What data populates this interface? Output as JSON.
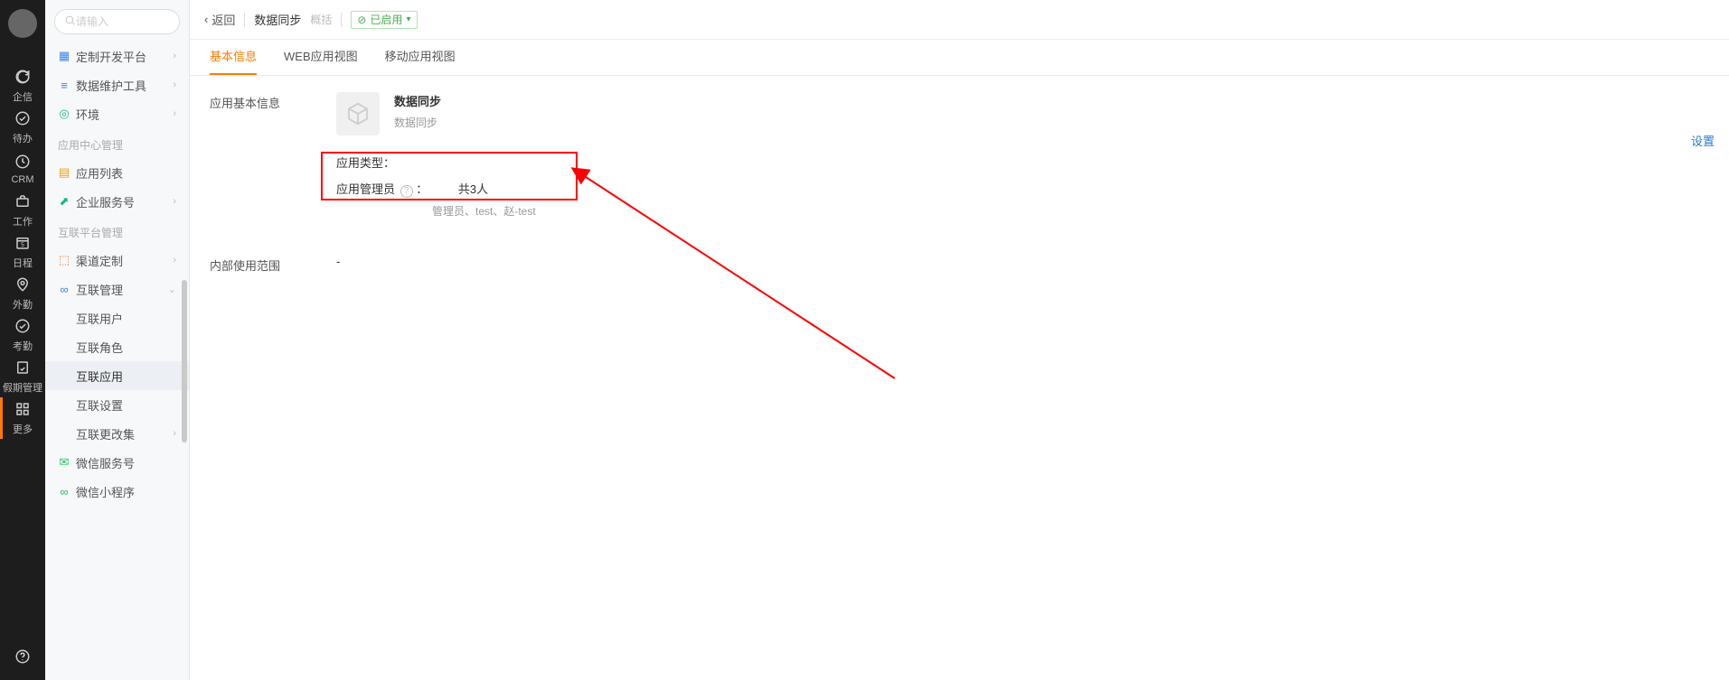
{
  "rail": {
    "items": [
      {
        "id": "qixin",
        "label": "企信"
      },
      {
        "id": "daiban",
        "label": "待办"
      },
      {
        "id": "crm",
        "label": "CRM"
      },
      {
        "id": "gongzuo",
        "label": "工作"
      },
      {
        "id": "richeng",
        "label": "日程",
        "badge": "5"
      },
      {
        "id": "waiqin",
        "label": "外勤"
      },
      {
        "id": "kaoqin",
        "label": "考勤"
      },
      {
        "id": "jiaqi",
        "label": "假期管理"
      },
      {
        "id": "gengduo",
        "label": "更多"
      }
    ]
  },
  "sidebar": {
    "search_placeholder": "请输入",
    "groups": [
      {
        "items": [
          {
            "label": "定制开发平台",
            "icon": "grid",
            "icon_color": "#3b82f6",
            "has_children": true
          },
          {
            "label": "数据维护工具",
            "icon": "bars",
            "icon_color": "#3b82f6",
            "has_children": true
          },
          {
            "label": "环境",
            "icon": "globe",
            "icon_color": "#10b981",
            "has_children": true
          }
        ]
      },
      {
        "title": "应用中心管理",
        "items": [
          {
            "label": "应用列表",
            "icon": "apps",
            "icon_color": "#f59e0b"
          },
          {
            "label": "企业服务号",
            "icon": "corp",
            "icon_color": "#10b981",
            "has_children": true
          }
        ]
      },
      {
        "title": "互联平台管理",
        "items": [
          {
            "label": "渠道定制",
            "icon": "channel",
            "icon_color": "#f97316",
            "has_children": true
          },
          {
            "label": "互联管理",
            "icon": "link",
            "icon_color": "#3b82f6",
            "expanded": true,
            "children": [
              {
                "label": "互联用户"
              },
              {
                "label": "互联角色"
              },
              {
                "label": "互联应用",
                "selected": true
              },
              {
                "label": "互联设置"
              },
              {
                "label": "互联更改集",
                "has_children": true
              }
            ]
          },
          {
            "label": "微信服务号",
            "icon": "wechat",
            "icon_color": "#22c55e"
          },
          {
            "label": "微信小程序",
            "icon": "wechat",
            "icon_color": "#22c55e"
          }
        ]
      }
    ]
  },
  "header": {
    "back": "返回",
    "title": "数据同步",
    "subtitle": "概括",
    "status": "已启用"
  },
  "tabs": [
    {
      "label": "基本信息",
      "active": true
    },
    {
      "label": "WEB应用视图"
    },
    {
      "label": "移动应用视图"
    }
  ],
  "detail": {
    "section_app_basic": "应用基本信息",
    "app_title": "数据同步",
    "app_desc": "数据同步",
    "row_app_type_label": "应用类型：",
    "row_app_type_value": "",
    "row_admin_label": "应用管理员",
    "row_admin_count": "共3人",
    "row_admin_people": "管理员、test、赵-test",
    "row_internal_scope_label": "内部使用范围",
    "row_internal_scope_value": "-",
    "settings_link": "设置"
  },
  "colors": {
    "accent": "#ff7a00",
    "highlight": "#ff0000"
  }
}
